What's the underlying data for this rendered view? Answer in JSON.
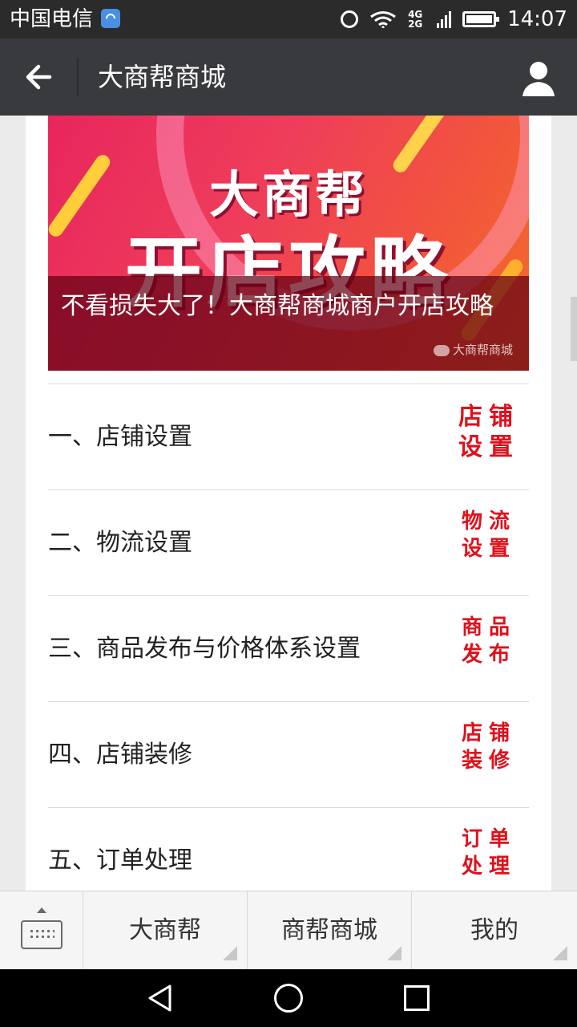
{
  "statusbar": {
    "carrier": "中国电信",
    "network": "4G 2G",
    "time": "14:07"
  },
  "titlebar": {
    "title": "大商帮商城"
  },
  "article": {
    "banner_line1": "大商帮",
    "banner_line2": "开店攻略",
    "caption": "不看损失大了！大商帮商城商户开店攻略",
    "source_tag": "大商帮商城"
  },
  "items": [
    {
      "title": "一、店铺设置",
      "thumb": "店铺设置"
    },
    {
      "title": "二、物流设置",
      "thumb": "物流设置"
    },
    {
      "title": "三、商品发布与价格体系设置",
      "thumb": "商品发布"
    },
    {
      "title": "四、店铺装修",
      "thumb": "店铺装修"
    },
    {
      "title": "五、订单处理",
      "thumb": "订单处理"
    }
  ],
  "menu": {
    "items": [
      "大商帮",
      "商帮商城",
      "我的"
    ]
  },
  "colors": {
    "titlebar": "#393a3e",
    "statusbar": "#2b2b2b",
    "thumb_red": "#e0101b"
  }
}
